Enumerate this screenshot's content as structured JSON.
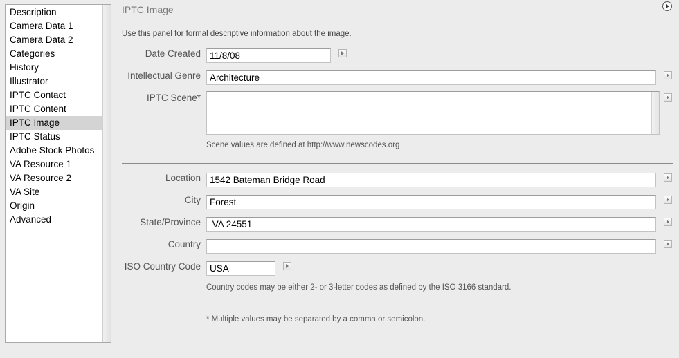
{
  "sidebar": {
    "items": [
      {
        "label": "Description"
      },
      {
        "label": "Camera Data 1"
      },
      {
        "label": "Camera Data 2"
      },
      {
        "label": "Categories"
      },
      {
        "label": "History"
      },
      {
        "label": "Illustrator"
      },
      {
        "label": "IPTC Contact"
      },
      {
        "label": "IPTC Content"
      },
      {
        "label": "IPTC Image"
      },
      {
        "label": "IPTC Status"
      },
      {
        "label": "Adobe Stock Photos"
      },
      {
        "label": "VA Resource 1"
      },
      {
        "label": "VA Resource 2"
      },
      {
        "label": "VA Site"
      },
      {
        "label": "Origin"
      },
      {
        "label": "Advanced"
      }
    ],
    "selected": "IPTC Image"
  },
  "panel": {
    "title": "IPTC Image",
    "description": "Use this panel for formal descriptive information about the image.",
    "date_created": {
      "label": "Date Created",
      "value": "11/8/08"
    },
    "intellectual_genre": {
      "label": "Intellectual Genre",
      "value": "Architecture"
    },
    "iptc_scene": {
      "label": "IPTC Scene*",
      "value": "",
      "hint": "Scene values are defined at http://www.newscodes.org"
    },
    "location": {
      "label": "Location",
      "value": "1542 Bateman Bridge Road"
    },
    "city": {
      "label": "City",
      "value": "Forest"
    },
    "state_province": {
      "label": "State/Province",
      "value": " VA 24551"
    },
    "country": {
      "label": "Country",
      "value": ""
    },
    "iso_country_code": {
      "label": "ISO Country Code",
      "value": "USA",
      "hint": "Country codes may be either 2- or 3-letter codes as defined by the ISO 3166 standard."
    },
    "footnote": "* Multiple values may be separated by a comma or semicolon."
  },
  "icons": {
    "panel_menu": "circle-play-icon",
    "field_menu": "triangle-right-icon"
  }
}
